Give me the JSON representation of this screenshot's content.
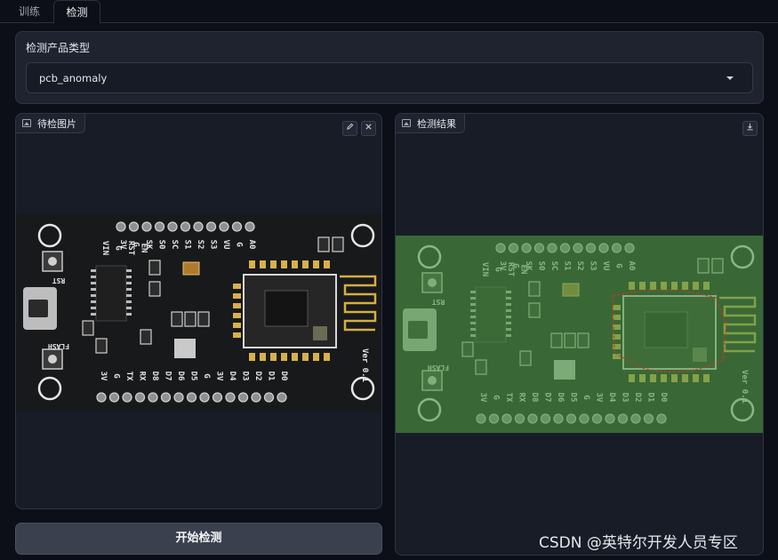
{
  "tabs": [
    {
      "label": "训练",
      "active": false
    },
    {
      "label": "检测",
      "active": true
    }
  ],
  "product_selector": {
    "label": "检测产品类型",
    "value": "pcb_anomaly"
  },
  "input_panel": {
    "label": "待检图片",
    "edit_icon": "pencil-icon",
    "clear_icon": "close-icon"
  },
  "result_panel": {
    "label": "检测结果",
    "download_icon": "download-icon"
  },
  "pcb": {
    "top_pins": [
      "A0",
      "G",
      "VU",
      "S3",
      "S2",
      "S1",
      "SC",
      "S0",
      "SK",
      "G",
      "3V"
    ],
    "top_left_labels": [
      "VIN",
      "G",
      "RST",
      "EN"
    ],
    "bottom_pins": [
      "3V",
      "G",
      "TX",
      "RX",
      "D8",
      "D7",
      "D6",
      "D5",
      "G",
      "3V",
      "D4",
      "D3",
      "D2",
      "D1",
      "D0"
    ],
    "rst_label": "RST",
    "flash_label": "FLASH",
    "ver_label": "Ver 0.1",
    "colors": {
      "board": "#17191b",
      "overlay": "#4f9a47",
      "anomaly": "#c0392b"
    }
  },
  "actions": {
    "start_label": "开始检测"
  },
  "watermark": "CSDN @英特尔开发人员专区"
}
